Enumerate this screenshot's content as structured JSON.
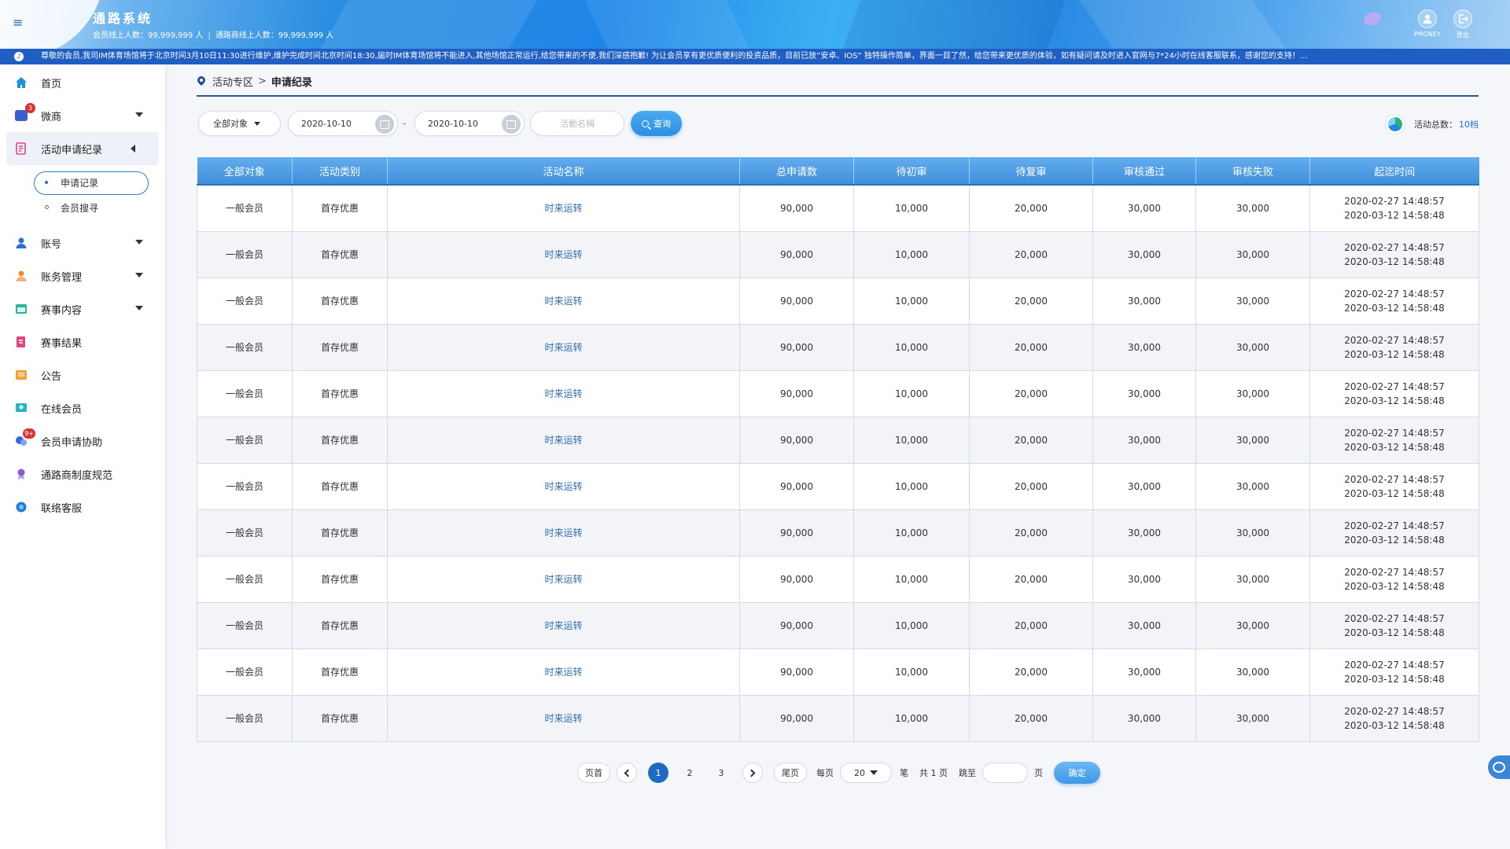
{
  "header": {
    "title": "通路系统",
    "member_online": "会员线上人数：99,999,999 人",
    "dealer_online": "通路商线上人数：99,999,999 人",
    "sep": "|",
    "pmoney_label": "PMONEY",
    "logout_label": "登出",
    "menu_glyph": "≡"
  },
  "marquee": {
    "text": "尊敬的会员,我司IM体育场馆将于北京时间3月10日11:30进行维护,维护完成时间北京时间18:30,届时IM体育场馆将不能进入,其他场馆正常运行,给您带来的不便,我们深感抱歉! 为让会员享有更优质便利的投资品质，目前已放”安卓、IOS” 独特操作简单，界面一目了然，给您带来更优质的体验，如有疑问请及时进入官网与7*24小时在线客服联系，感谢您的支持！..."
  },
  "sidebar": {
    "items": [
      {
        "label": "首页",
        "icon": "home-icon",
        "color": "#1e8fe0"
      },
      {
        "label": "微商",
        "icon": "shop-icon",
        "color": "#3b5fd1",
        "badge": "3",
        "caret": "down"
      },
      {
        "label": "活动申请纪录",
        "icon": "activity-record-icon",
        "color": "#e5467a",
        "caret": "left"
      },
      {
        "label": "账号",
        "icon": "account-icon",
        "color": "#2a6fd1",
        "caret": "down"
      },
      {
        "label": "账务管理",
        "icon": "finance-icon",
        "color": "#f08a3c",
        "caret": "down"
      },
      {
        "label": "赛事内容",
        "icon": "event-content-icon",
        "color": "#2bb59a",
        "caret": "down"
      },
      {
        "label": "赛事结果",
        "icon": "event-result-icon",
        "color": "#e0457f"
      },
      {
        "label": "公告",
        "icon": "notice-icon",
        "color": "#f2a33a"
      },
      {
        "label": "在线会员",
        "icon": "online-member-icon",
        "color": "#27b2c9"
      },
      {
        "label": "会员申请协助",
        "icon": "member-help-icon",
        "color": "#3a6ad6",
        "badge": "9+"
      },
      {
        "label": "通路商制度规范",
        "icon": "policy-icon",
        "color": "#8a5ad6"
      },
      {
        "label": "联络客服",
        "icon": "customer-service-icon",
        "color": "#1e7fd6"
      }
    ],
    "sub_items": [
      {
        "label": "申请记录",
        "selected": true
      },
      {
        "label": "会员搜寻",
        "selected": false
      }
    ]
  },
  "breadcrumb": {
    "parent": "活动专区",
    "sep": ">",
    "current": "申请纪录"
  },
  "filters": {
    "target": "全部对象",
    "date_from": "2020-10-10",
    "date_to": "2020-10-10",
    "date_sep": "-",
    "name_placeholder": "活動名稱",
    "search_label": "查询"
  },
  "total": {
    "label": "活动总数：",
    "value": "10档"
  },
  "table": {
    "columns": [
      "全部对象",
      "活动类别",
      "活动名称",
      "总申请数",
      "待初审",
      "待复审",
      "审核通过",
      "审核失败",
      "起迄时间"
    ],
    "rows": [
      {
        "target": "一般会员",
        "category": "首存优惠",
        "name": "时来运转",
        "total": "90,000",
        "pending1": "10,000",
        "pending2": "20,000",
        "passed": "30,000",
        "failed": "30,000",
        "start": "2020-02-27 14:48:57",
        "end": "2020-03-12 14:58:48"
      },
      {
        "target": "一般会员",
        "category": "首存优惠",
        "name": "时来运转",
        "total": "90,000",
        "pending1": "10,000",
        "pending2": "20,000",
        "passed": "30,000",
        "failed": "30,000",
        "start": "2020-02-27 14:48:57",
        "end": "2020-03-12 14:58:48"
      },
      {
        "target": "一般会员",
        "category": "首存优惠",
        "name": "时来运转",
        "total": "90,000",
        "pending1": "10,000",
        "pending2": "20,000",
        "passed": "30,000",
        "failed": "30,000",
        "start": "2020-02-27 14:48:57",
        "end": "2020-03-12 14:58:48"
      },
      {
        "target": "一般会员",
        "category": "首存优惠",
        "name": "时来运转",
        "total": "90,000",
        "pending1": "10,000",
        "pending2": "20,000",
        "passed": "30,000",
        "failed": "30,000",
        "start": "2020-02-27 14:48:57",
        "end": "2020-03-12 14:58:48"
      },
      {
        "target": "一般会员",
        "category": "首存优惠",
        "name": "时来运转",
        "total": "90,000",
        "pending1": "10,000",
        "pending2": "20,000",
        "passed": "30,000",
        "failed": "30,000",
        "start": "2020-02-27 14:48:57",
        "end": "2020-03-12 14:58:48"
      },
      {
        "target": "一般会员",
        "category": "首存优惠",
        "name": "时来运转",
        "total": "90,000",
        "pending1": "10,000",
        "pending2": "20,000",
        "passed": "30,000",
        "failed": "30,000",
        "start": "2020-02-27 14:48:57",
        "end": "2020-03-12 14:58:48"
      },
      {
        "target": "一般会员",
        "category": "首存优惠",
        "name": "时来运转",
        "total": "90,000",
        "pending1": "10,000",
        "pending2": "20,000",
        "passed": "30,000",
        "failed": "30,000",
        "start": "2020-02-27 14:48:57",
        "end": "2020-03-12 14:58:48"
      },
      {
        "target": "一般会员",
        "category": "首存优惠",
        "name": "时来运转",
        "total": "90,000",
        "pending1": "10,000",
        "pending2": "20,000",
        "passed": "30,000",
        "failed": "30,000",
        "start": "2020-02-27 14:48:57",
        "end": "2020-03-12 14:58:48"
      },
      {
        "target": "一般会员",
        "category": "首存优惠",
        "name": "时来运转",
        "total": "90,000",
        "pending1": "10,000",
        "pending2": "20,000",
        "passed": "30,000",
        "failed": "30,000",
        "start": "2020-02-27 14:48:57",
        "end": "2020-03-12 14:58:48"
      },
      {
        "target": "一般会员",
        "category": "首存优惠",
        "name": "时来运转",
        "total": "90,000",
        "pending1": "10,000",
        "pending2": "20,000",
        "passed": "30,000",
        "failed": "30,000",
        "start": "2020-02-27 14:48:57",
        "end": "2020-03-12 14:58:48"
      },
      {
        "target": "一般会员",
        "category": "首存优惠",
        "name": "时来运转",
        "total": "90,000",
        "pending1": "10,000",
        "pending2": "20,000",
        "passed": "30,000",
        "failed": "30,000",
        "start": "2020-02-27 14:48:57",
        "end": "2020-03-12 14:58:48"
      },
      {
        "target": "一般会员",
        "category": "首存优惠",
        "name": "时来运转",
        "total": "90,000",
        "pending1": "10,000",
        "pending2": "20,000",
        "passed": "30,000",
        "failed": "30,000",
        "start": "2020-02-27 14:48:57",
        "end": "2020-03-12 14:58:48"
      }
    ]
  },
  "pagination": {
    "first": "页首",
    "last": "尾页",
    "pages": [
      "1",
      "2",
      "3"
    ],
    "current": "1",
    "per_page_label": "每页",
    "per_page": "20",
    "unit": "笔",
    "total_pages": "共 1 页",
    "jump_label": "跳至",
    "page_unit": "页",
    "confirm": "确定"
  }
}
